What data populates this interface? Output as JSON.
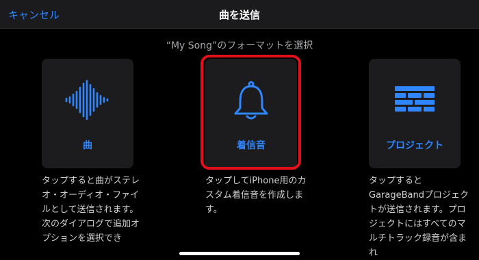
{
  "navbar": {
    "cancel_label": "キャンセル",
    "title": "曲を送信"
  },
  "subtitle": "“My Song”のフォーマットを選択",
  "options": [
    {
      "label": "曲",
      "icon": "waveform-icon",
      "description": "タップすると曲がステレオ・オーディオ・ファイルとして送信されます。次のダイアログで追加オプションを選択でき"
    },
    {
      "label": "着信音",
      "icon": "bell-icon",
      "description": "タップしてiPhone用のカスタム着信音を作成します。",
      "selected": true
    },
    {
      "label": "プロジェクト",
      "icon": "brick-wall-icon",
      "description": "タップするとGarageBandプロジェクトが送信されます。プロジェクトにはすべてのマルチトラック録音が含まれ"
    }
  ],
  "colors": {
    "accent": "#2f86ff",
    "highlight": "#e3101b",
    "tile_background": "#1c1c1e"
  }
}
